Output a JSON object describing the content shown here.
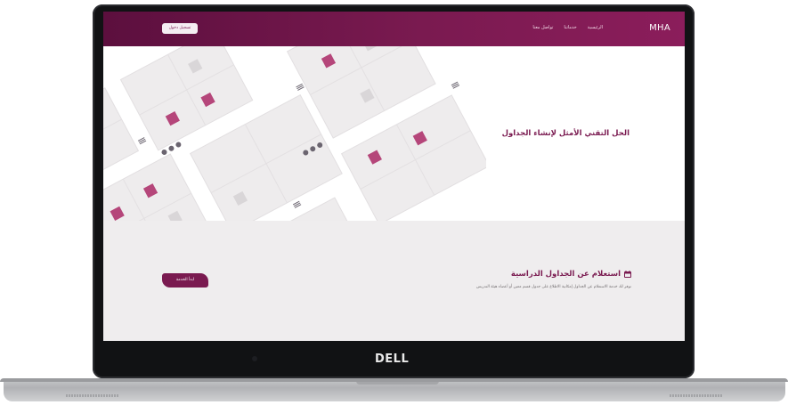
{
  "device": {
    "logo": "DELL"
  },
  "nav": {
    "brand": "MHA",
    "links": [
      "الرئيسية",
      "خدماتنا",
      "تواصل معنا"
    ],
    "login": "تسجيل دخول"
  },
  "hero": {
    "title": "الحل التقني الأمثل لإنشاء الجداول"
  },
  "feature": {
    "title": "استعلام عن الجداول الدراسية",
    "icon": "calendar-icon",
    "description": "توفر لك خدمة الاستعلام عن الجداول إمكانية الاطلاع على جدول قسم معين أو أعضاء هيئة التدريس",
    "button": "ابدأ الخدمة"
  },
  "colors": {
    "brand": "#7a1a50",
    "tile": "#b5467a",
    "band": "#efedee"
  }
}
